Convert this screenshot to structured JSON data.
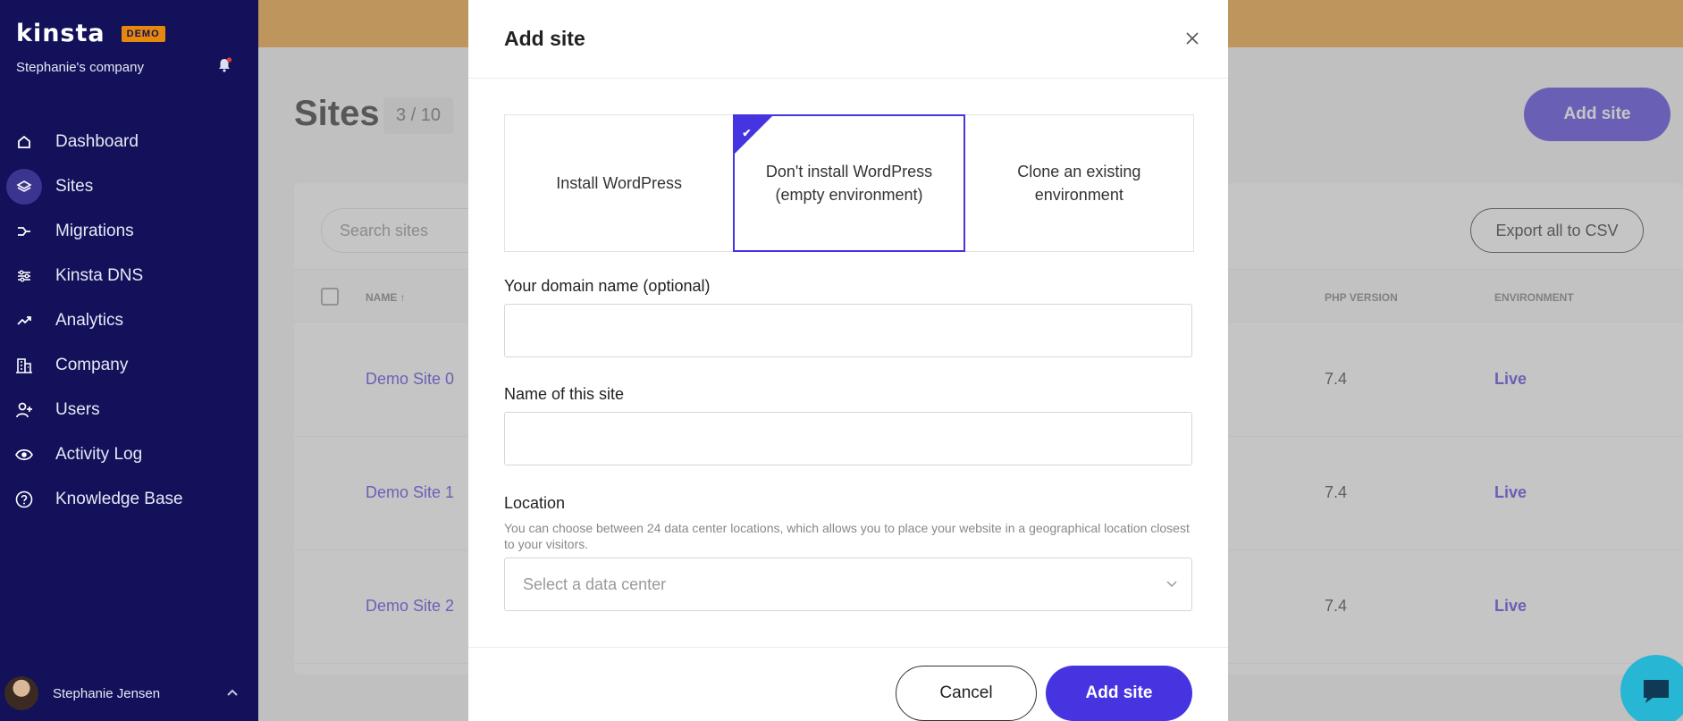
{
  "sidebar": {
    "logo": "kinsta",
    "badge": "DEMO",
    "company": "Stephanie's company",
    "items": [
      {
        "label": "Dashboard",
        "icon": "home-icon"
      },
      {
        "label": "Sites",
        "icon": "layers-icon",
        "active": true
      },
      {
        "label": "Migrations",
        "icon": "migrations-icon"
      },
      {
        "label": "Kinsta DNS",
        "icon": "dns-icon"
      },
      {
        "label": "Analytics",
        "icon": "analytics-icon"
      },
      {
        "label": "Company",
        "icon": "building-icon"
      },
      {
        "label": "Users",
        "icon": "user-plus-icon"
      },
      {
        "label": "Activity Log",
        "icon": "eye-icon"
      },
      {
        "label": "Knowledge Base",
        "icon": "help-icon"
      }
    ],
    "user_name": "Stephanie Jensen"
  },
  "page": {
    "title": "Sites",
    "count": "3 / 10",
    "add_site_label": "Add site",
    "search_placeholder": "Search sites",
    "export_label": "Export all to CSV",
    "columns": {
      "name": "NAME ↑",
      "php": "PHP VERSION",
      "env": "ENVIRONMENT"
    },
    "rows": [
      {
        "name": "Demo Site 0",
        "php": "7.4",
        "env": "Live"
      },
      {
        "name": "Demo Site 1",
        "php": "7.4",
        "env": "Live"
      },
      {
        "name": "Demo Site 2",
        "php": "7.4",
        "env": "Live"
      }
    ]
  },
  "modal": {
    "title": "Add site",
    "options": [
      {
        "label": "Install WordPress",
        "selected": false
      },
      {
        "label": "Don't install WordPress (empty environment)",
        "selected": true
      },
      {
        "label": "Clone an existing environment",
        "selected": false
      }
    ],
    "domain_label": "Your domain name (optional)",
    "domain_value": "",
    "site_name_label": "Name of this site",
    "site_name_value": "",
    "location_label": "Location",
    "location_help": "You can choose between 24 data center locations, which allows you to place your website in a geographical location closest to your visitors.",
    "location_placeholder": "Select a data center",
    "cancel_label": "Cancel",
    "submit_label": "Add site"
  },
  "colors": {
    "sidebar_bg": "#12115a",
    "accent": "#4634e0",
    "banner": "#ef9f2f",
    "chat": "#27b6d3"
  }
}
